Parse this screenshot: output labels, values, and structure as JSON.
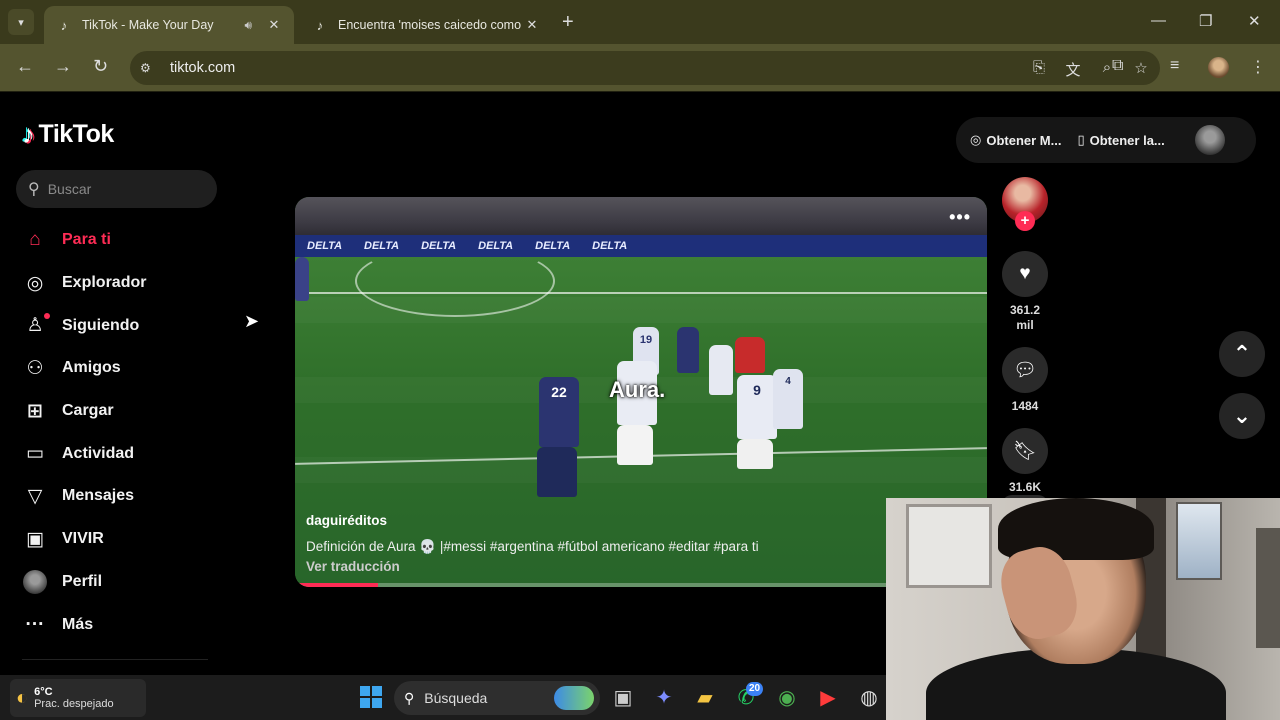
{
  "browser": {
    "tabs": [
      {
        "title": "TikTok - Make Your Day",
        "active": true,
        "audio": true
      },
      {
        "title": "Encuentra 'moises caicedo como",
        "active": false
      }
    ],
    "address": "tiktok.com",
    "icons": {
      "back": "arrow-left-icon",
      "forward": "arrow-right-icon",
      "reload": "reload-icon"
    }
  },
  "tiktok": {
    "logo_text": "TikTok",
    "search": {
      "placeholder": "Buscar"
    },
    "nav": [
      {
        "label": "Para ti",
        "icon": "home-icon",
        "active": true
      },
      {
        "label": "Explorador",
        "icon": "compass-icon"
      },
      {
        "label": "Siguiendo",
        "icon": "following-icon",
        "dot": true
      },
      {
        "label": "Amigos",
        "icon": "friends-icon"
      },
      {
        "label": "Cargar",
        "icon": "upload-icon"
      },
      {
        "label": "Actividad",
        "icon": "activity-icon"
      },
      {
        "label": "Mensajes",
        "icon": "messages-icon"
      },
      {
        "label": "VIVIR",
        "icon": "live-icon"
      },
      {
        "label": "Perfil",
        "icon": "profile-icon"
      },
      {
        "label": "Más",
        "icon": "more-icon"
      }
    ],
    "top_actions": {
      "get_coins": "Obtener M...",
      "get_app": "Obtener la..."
    },
    "video": {
      "overlay_caption": "Aura.",
      "author": "daguiréditos",
      "description": "Definición de Aura 💀 |#messi #argentina #fútbol americano #editar #para ti",
      "translate": "Ver traducción",
      "progress": 0.12,
      "board_text": [
        "DELTA",
        "DELTA",
        "DELTA",
        "DELTA",
        "DELTA",
        "DELTA"
      ],
      "jersey_numbers": [
        "22",
        "19",
        "9",
        "4"
      ]
    },
    "actions": {
      "likes": "361.2",
      "likes_unit": "mil",
      "comments": "1484",
      "saves": "31.6K"
    }
  },
  "taskbar": {
    "weather_temp": "6°C",
    "weather_cond": "Prac. despejado",
    "search_label": "Búsqueda",
    "whatsapp_badge": "20"
  },
  "colors": {
    "accent": "#fe2c55",
    "chrome_frame": "#3a3a1c",
    "chrome_toolbar": "#54542f"
  }
}
